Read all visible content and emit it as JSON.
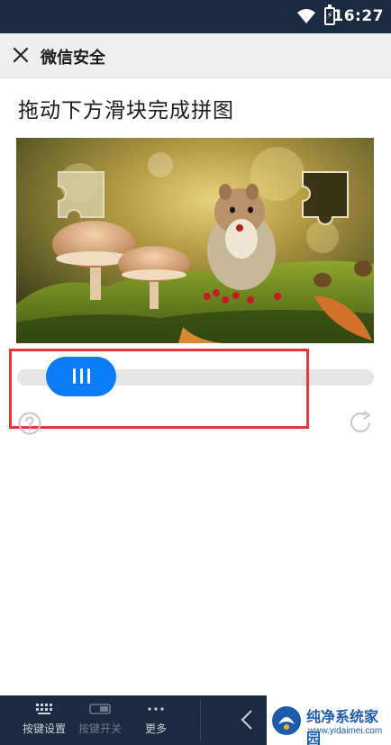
{
  "status_bar": {
    "time": "16:27",
    "battery_glyph": "⚡"
  },
  "title_bar": {
    "title": "微信安全",
    "close_icon": "close-icon"
  },
  "captcha": {
    "instruction": "拖动下方滑块完成拼图",
    "slider_progress": 0.08,
    "accent_color": "#0b7cf8",
    "highlight_color": "#e8373d"
  },
  "bottom_bar": {
    "items": [
      {
        "label": "按键设置",
        "icon": "keyboard-icon",
        "enabled": true
      },
      {
        "label": "按键开关",
        "icon": "toggle-icon",
        "enabled": false
      },
      {
        "label": "更多",
        "icon": "more-icon",
        "enabled": true
      }
    ]
  },
  "watermark": {
    "name": "纯净系统家园",
    "url": "www.yidaimei.com"
  }
}
